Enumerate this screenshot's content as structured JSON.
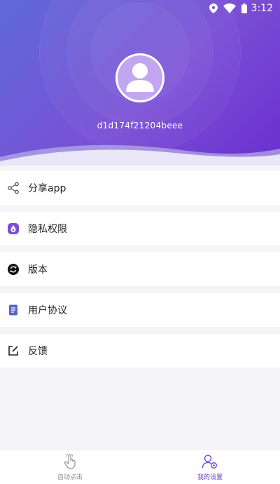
{
  "status_bar": {
    "time": "3:12",
    "icons": [
      "location-icon",
      "wifi-icon",
      "battery-icon"
    ]
  },
  "profile": {
    "user_id": "d1d174f21204beee"
  },
  "menu": {
    "items": [
      {
        "label": "分享app",
        "icon": "share-icon"
      },
      {
        "label": "隐私权限",
        "icon": "privacy-icon"
      },
      {
        "label": "版本",
        "icon": "version-icon"
      },
      {
        "label": "用户协议",
        "icon": "agreement-icon"
      },
      {
        "label": "反馈",
        "icon": "feedback-icon"
      }
    ]
  },
  "tabbar": {
    "tabs": [
      {
        "label": "自动点击",
        "icon": "tap-hand-icon",
        "active": false
      },
      {
        "label": "我的设置",
        "icon": "user-settings-icon",
        "active": true
      }
    ]
  },
  "colors": {
    "header_start": "#5f6ad8",
    "header_end": "#6a2fcf",
    "accent": "#6a38d6",
    "background": "#f5f5f7"
  }
}
